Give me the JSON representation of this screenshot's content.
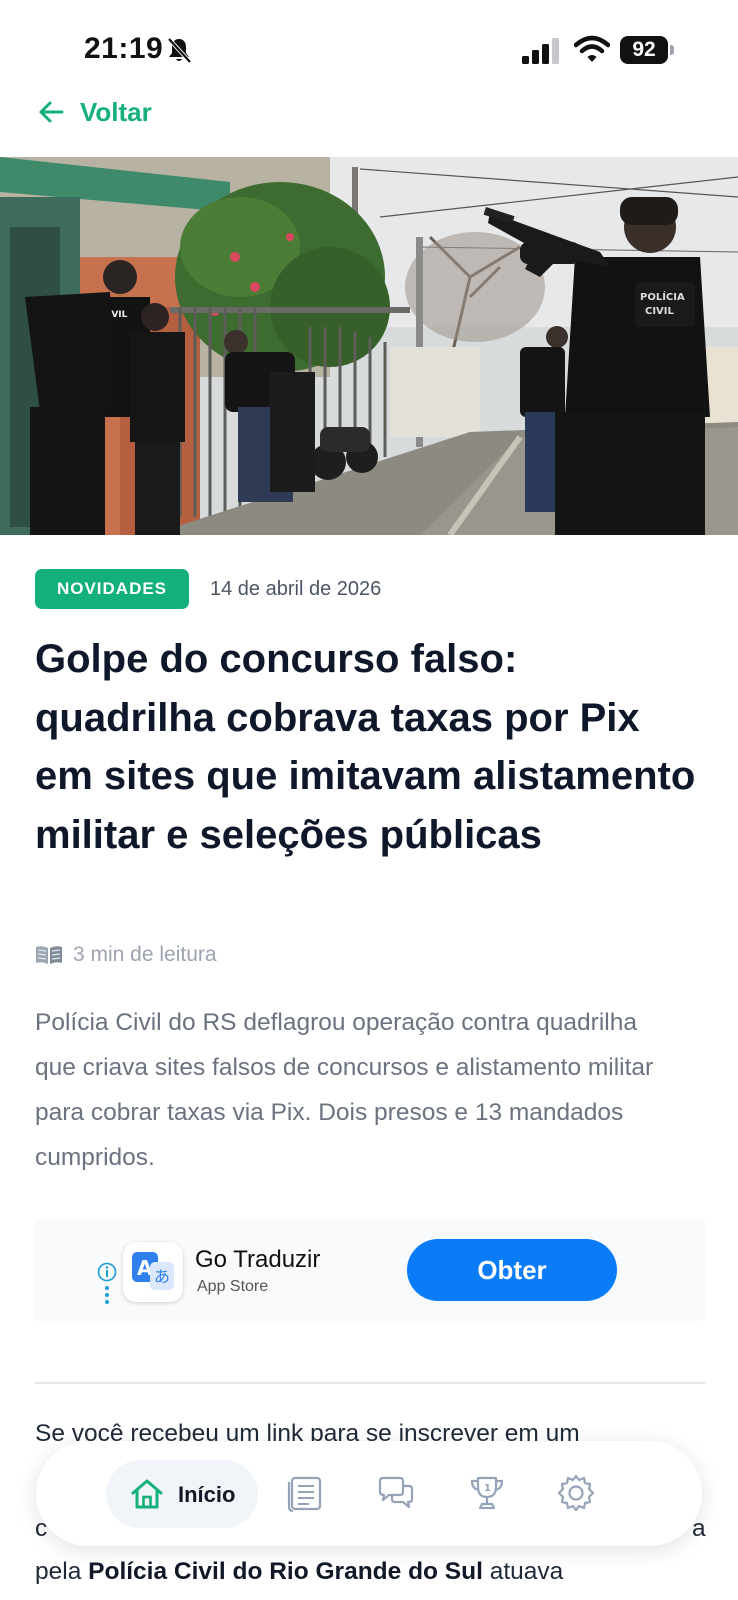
{
  "status_bar": {
    "time": "21:19",
    "battery": "92"
  },
  "nav": {
    "back_label": "Voltar"
  },
  "article": {
    "category": "NOVIDADES",
    "date": "14 de abril de 2026",
    "title": "Golpe do concurso falso: quadrilha cobrava taxas por Pix em sites que imitavam alistamento militar e seleções públicas",
    "read_time": "3 min de leitura",
    "summary": "Polícia Civil do RS deflagrou operação contra quadrilha que criava sites falsos de concursos e alistamento militar para cobrar taxas via Pix. Dois presos e 13 mandados cumpridos.",
    "body_line_1": "Se você recebeu um link para se inscrever em um",
    "body_line_2_start": "c",
    "body_line_2_end": "a",
    "body_line_3_prefix": "pela ",
    "body_line_3_bold": "Polícia Civil do Rio Grande do Sul",
    "body_line_3_suffix": " atuava"
  },
  "ad": {
    "app_name": "Go Traduzir",
    "store": "App Store",
    "cta": "Obter"
  },
  "bottom_nav": {
    "home_label": "Início"
  },
  "colors": {
    "accent": "#16b07a",
    "ad_cta": "#0a7cf7",
    "title": "#0f172a",
    "muted": "#6b7280"
  },
  "icons": {
    "back": "arrow-left-icon",
    "read_time": "open-book-icon",
    "nav": [
      "home-icon",
      "article-list-icon",
      "chat-bubbles-icon",
      "trophy-icon",
      "gear-icon"
    ]
  },
  "hero_image": {
    "vest_text": "POLÍCIA CIVIL"
  }
}
